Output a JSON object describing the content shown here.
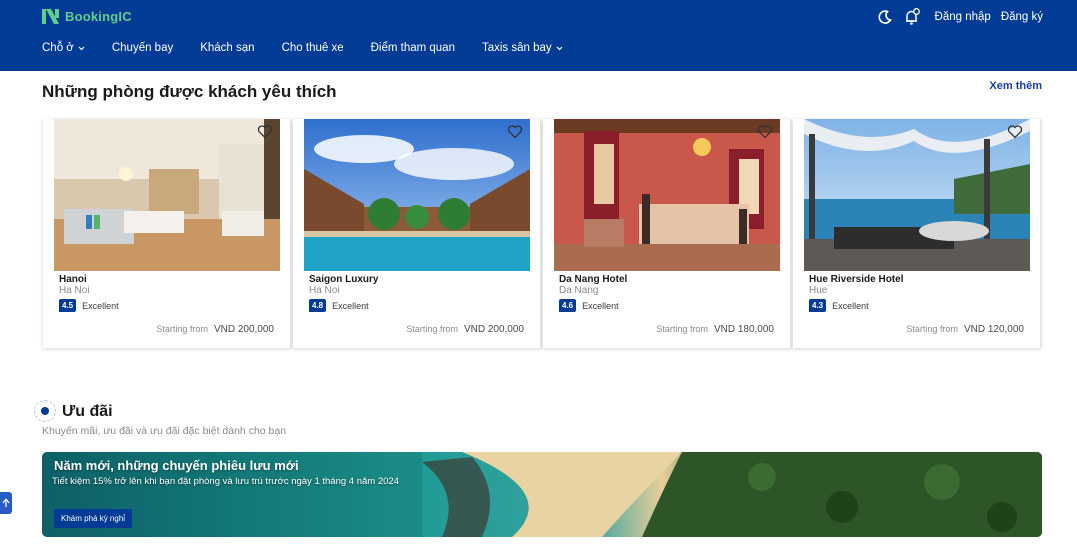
{
  "header": {
    "brand": "BookingIC",
    "login_label": "Đăng nhập",
    "register_label": "Đăng ký",
    "nav": [
      {
        "label": "Chỗ ở",
        "dropdown": true
      },
      {
        "label": "Chuyến bay",
        "dropdown": false
      },
      {
        "label": "Khách sạn",
        "dropdown": false
      },
      {
        "label": "Cho thuê xe",
        "dropdown": false
      },
      {
        "label": "Điểm tham quan",
        "dropdown": false
      },
      {
        "label": "Taxis sân bay",
        "dropdown": true
      }
    ]
  },
  "favorites": {
    "title": "Những phòng được khách yêu thích",
    "see_more": "Xem thêm",
    "cards": [
      {
        "name": "Hanoi",
        "city": "Ha Noi",
        "score": "4.5",
        "rating_text": "Excellent",
        "price_prefix": "Starting from",
        "price": "VND 200,000",
        "photo": "bright hotel room"
      },
      {
        "name": "Saigon Luxury",
        "city": "Ha Noi",
        "score": "4.8",
        "rating_text": "Excellent",
        "price_prefix": "Starting from",
        "price": "VND 200,000",
        "photo": "resort pool"
      },
      {
        "name": "Da Nang Hotel",
        "city": "Da Nang",
        "score": "4.6",
        "rating_text": "Excellent",
        "price_prefix": "Starting from",
        "price": "VND 180,000",
        "photo": "red classic bedroom"
      },
      {
        "name": "Hue Riverside Hotel",
        "city": "Hue",
        "score": "4.3",
        "rating_text": "Excellent",
        "price_prefix": "Starting from",
        "price": "VND 120,000",
        "photo": "sea view terrace"
      }
    ]
  },
  "deals": {
    "title": "Ưu đãi",
    "subtitle": "Khuyến mãi, ưu đãi và ưu đãi đặc biệt dành cho bạn",
    "banner_title": "Năm mới, những chuyến phiêu lưu mới",
    "banner_text": "Tiết kiệm 15% trở lên khi bạn đặt phòng và lưu trú trước ngày 1 tháng 4 năm 2024",
    "banner_button": "Khám phá kỳ nghỉ"
  },
  "colors": {
    "header_bg": "#003b95",
    "brand_green": "#5fd08c",
    "link_blue": "#1a3f9e"
  }
}
